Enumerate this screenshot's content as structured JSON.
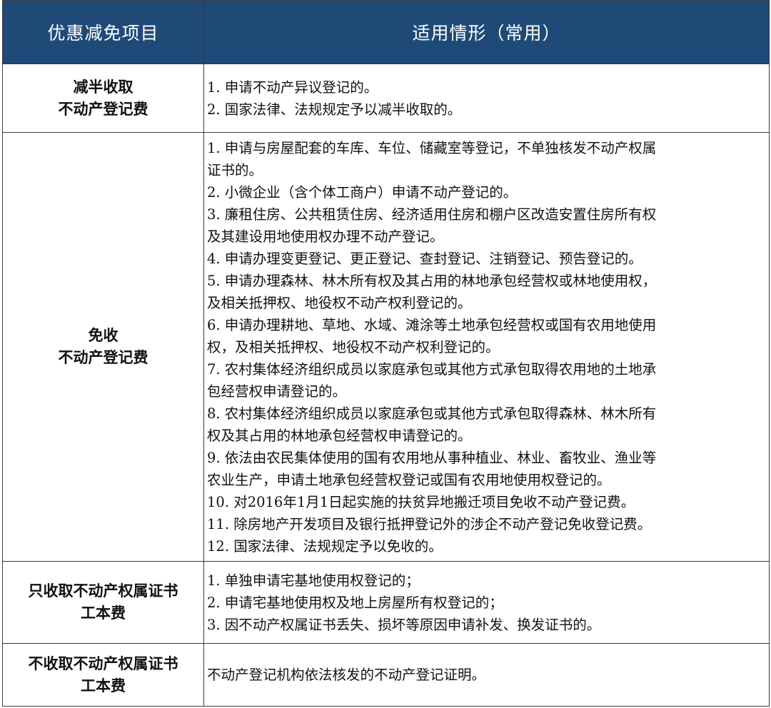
{
  "header": {
    "col_item": "优惠减免项目",
    "col_case": "适用情形（常用）"
  },
  "rows": [
    {
      "item_lines": [
        "减半收取",
        "不动产登记费"
      ],
      "cases": [
        "1. 申请不动产异议登记的。",
        "2. 国家法律、法规规定予以减半收取的。"
      ]
    },
    {
      "item_lines": [
        "免收",
        "不动产登记费"
      ],
      "cases": [
        "1. 申请与房屋配套的车库、车位、储藏室等登记，不单独核发不动产权属",
        "证书的。",
        "2. 小微企业（含个体工商户）申请不动产登记的。",
        "3. 廉租住房、公共租赁住房、经济适用住房和棚户区改造安置住房所有权",
        "及其建设用地使用权办理不动产登记。",
        "4. 申请办理变更登记、更正登记、查封登记、注销登记、预告登记的。",
        "5. 申请办理森林、林木所有权及其占用的林地承包经营权或林地使用权，",
        "及相关抵押权、地役权不动产权利登记的。",
        "6. 申请办理耕地、草地、水域、滩涂等土地承包经营权或国有农用地使用",
        "权，及相关抵押权、地役权不动产权利登记的。",
        "7. 农村集体经济组织成员以家庭承包或其他方式承包取得农用地的土地承",
        "包经营权申请登记的。",
        "8. 农村集体经济组织成员以家庭承包或其他方式承包取得森林、林木所有",
        "权及其占用的林地承包经营权申请登记的。",
        "9. 依法由农民集体使用的国有农用地从事种植业、林业、畜牧业、渔业等",
        "农业生产，申请土地承包经营权登记或国有农用地使用权登记的。",
        "10. 对2016年1月1日起实施的扶贫异地搬迁项目免收不动产登记费。",
        "11. 除房地产开发项目及银行抵押登记外的涉企不动产登记免收登记费。",
        "12. 国家法律、法规规定予以免收的。"
      ]
    },
    {
      "item_lines": [
        "只收取不动产权属证书",
        "工本费"
      ],
      "cases": [
        "1. 单独申请宅基地使用权登记的；",
        "2. 申请宅基地使用权及地上房屋所有权登记的；",
        "3. 因不动产权属证书丢失、损坏等原因申请补发、换发证书的。"
      ]
    },
    {
      "item_lines": [
        "不收取不动产权属证书",
        "工本费"
      ],
      "cases": [
        "不动产登记机构依法核发的不动产登记证明。"
      ]
    }
  ]
}
